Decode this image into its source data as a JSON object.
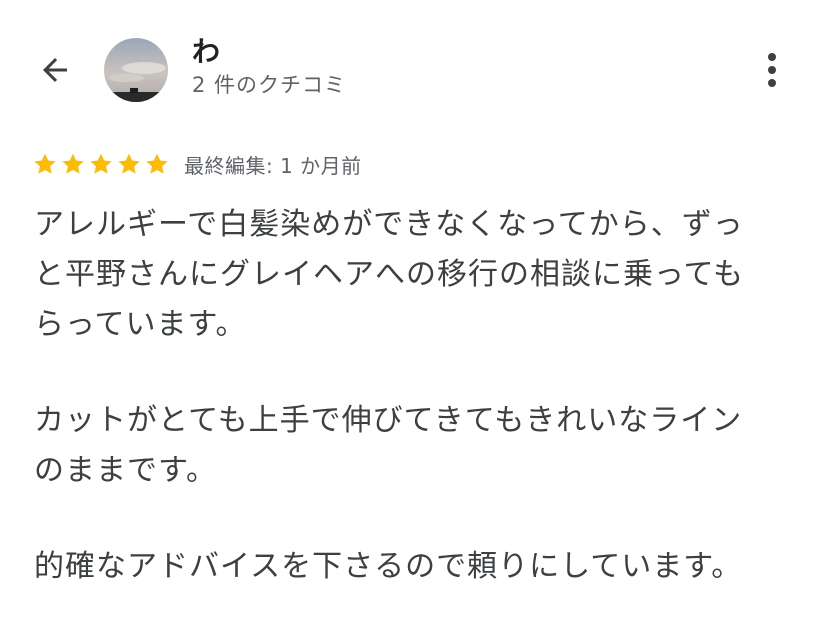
{
  "header": {
    "back_icon": "arrow-back-icon",
    "reviewer_name": "わ",
    "review_count": "2 件のクチコミ",
    "more_icon": "more-vert-icon"
  },
  "rating": {
    "stars": 5,
    "max_stars": 5,
    "star_color": "#fbbc04",
    "edited_text": "最終編集: 1 か月前"
  },
  "review": {
    "paragraphs": [
      {
        "lines": [
          "アレルギーで白髪染めができなくなってから、ずっ",
          "と平野さんにグレイヘアへの移行の相談に乗っても",
          "らっています。"
        ]
      },
      {
        "lines": [
          "カットがとても上手で伸びてきてもきれいなライン",
          "のままです。"
        ]
      },
      {
        "lines": [
          "的確なアドバイスを下さるので頼りにしています。"
        ]
      }
    ]
  }
}
